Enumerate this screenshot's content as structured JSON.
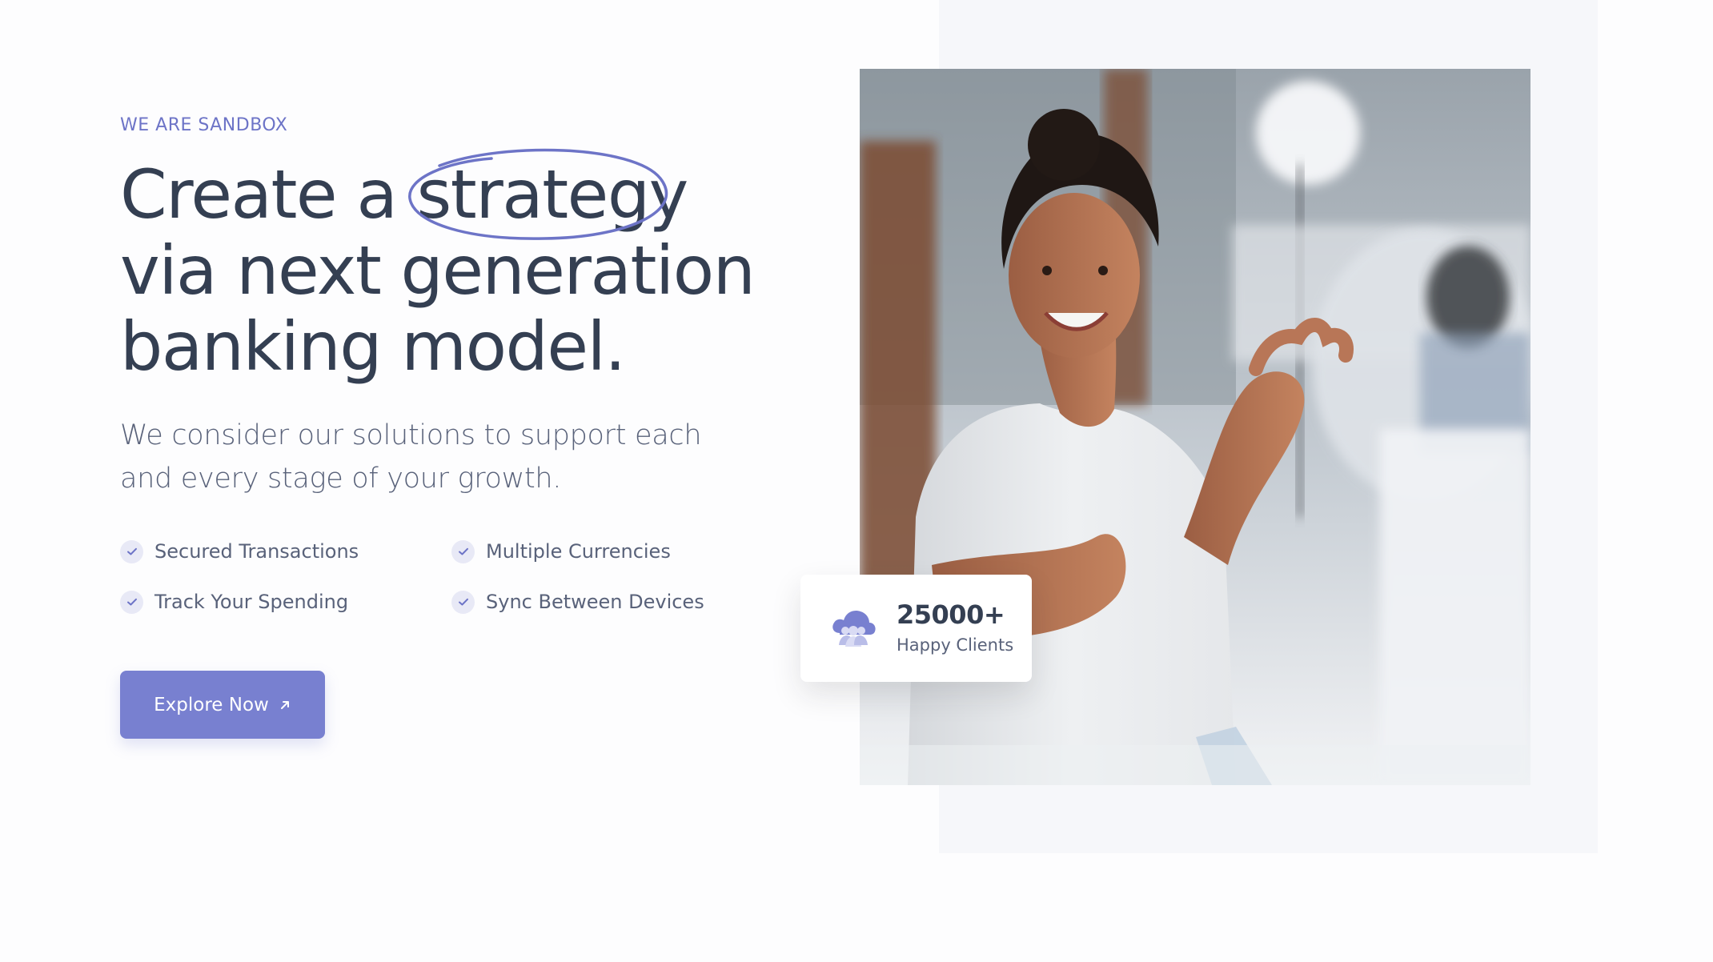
{
  "hero": {
    "eyebrow": "WE ARE SANDBOX",
    "headline": {
      "line1_prefix": "Create a",
      "line1_highlight": "strategy",
      "line2": "via next generation",
      "line3": "banking model."
    },
    "lead": "We consider our solutions to support each and every stage of your growth.",
    "features": [
      "Secured Transactions",
      "Multiple Currencies",
      "Track Your Spending",
      "Sync Between Devices"
    ],
    "cta_label": "Explore Now"
  },
  "stat_card": {
    "value": "25000+",
    "label": "Happy Clients",
    "icon": "users-cloud-icon"
  },
  "colors": {
    "accent": "#7880d0",
    "accent_text": "#6d74c7",
    "heading": "#343f52",
    "body": "#59627a",
    "panel": "#f6f7fa"
  }
}
